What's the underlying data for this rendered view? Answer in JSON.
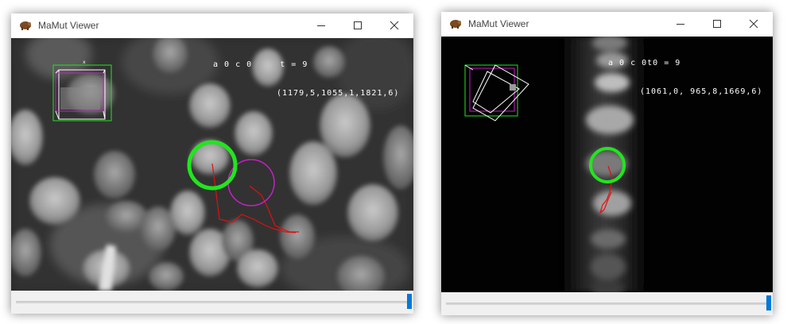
{
  "windows": [
    {
      "title": "MaMut Viewer",
      "overlay_line1": "a 0 c 0     t = 9",
      "overlay_line2": "(1179,5,1055,1,1821,6)",
      "slider_value": 1.0
    },
    {
      "title": "MaMut Viewer",
      "overlay_line1": "a 0 c 0t0 = 9",
      "overlay_line2": "(1061,0, 965,8,1669,6)",
      "slider_value": 1.0
    }
  ],
  "colors": {
    "selected_spot": "#22e51e",
    "other_spot": "#c81fc8",
    "track": "#e01010",
    "slider_thumb": "#0078d7"
  },
  "icons": [
    "mamut-app-icon",
    "minimize-icon",
    "maximize-icon",
    "close-icon"
  ]
}
